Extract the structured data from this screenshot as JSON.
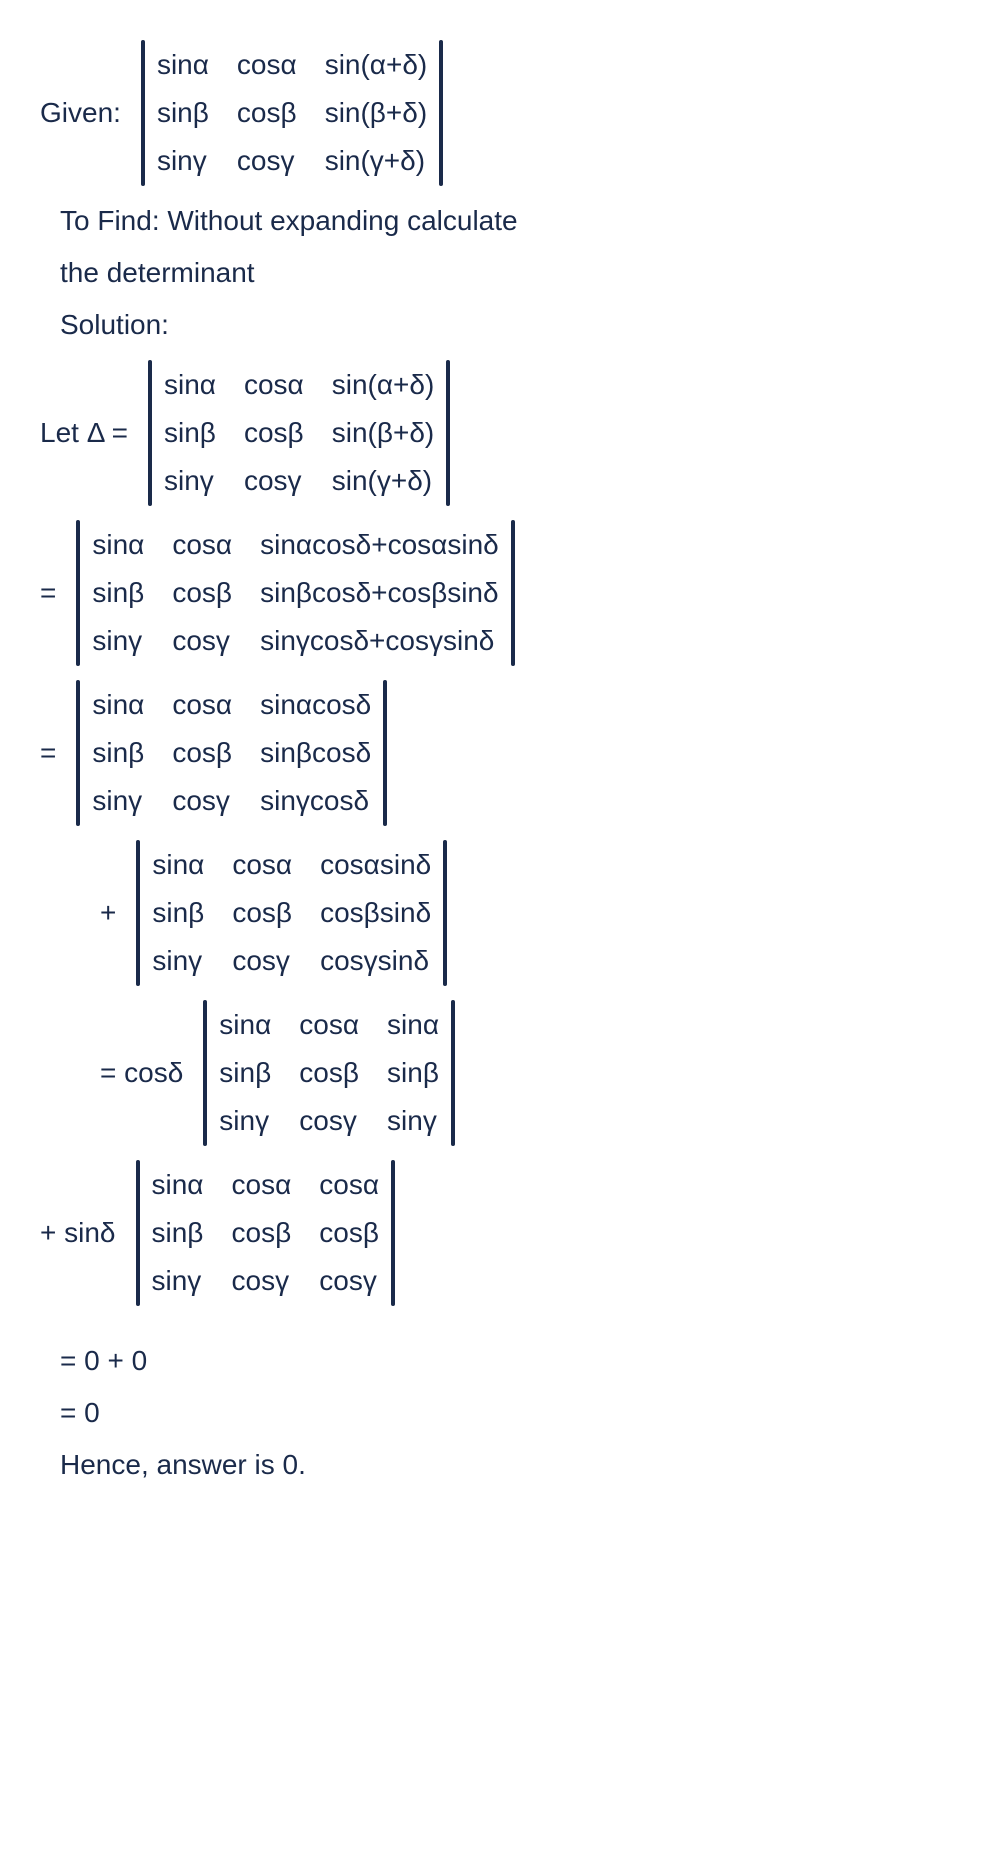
{
  "given_label": "Given:",
  "to_find": "To Find: Without expanding calculate",
  "to_find_2": "the determinant",
  "solution_label": "Solution:",
  "let_delta": "Let Δ =",
  "eq": "=",
  "plus": "+",
  "coeff_cos": "= cosδ",
  "coeff_sin": "+ sinδ",
  "result1": "= 0 + 0",
  "result2": "= 0",
  "answer": "Hence, answer is 0.",
  "m_given": {
    "r1c1": "sinα",
    "r1c2": "cosα",
    "r1c3": "sin(α+δ)",
    "r2c1": "sinβ",
    "r2c2": "cosβ",
    "r2c3": "sin(β+δ)",
    "r3c1": "sinγ",
    "r3c2": "cosγ",
    "r3c3": "sin(γ+δ)"
  },
  "m_delta": {
    "r1c1": "sinα",
    "r1c2": "cosα",
    "r1c3": "sin(α+δ)",
    "r2c1": "sinβ",
    "r2c2": "cosβ",
    "r2c3": "sin(β+δ)",
    "r3c1": "sinγ",
    "r3c2": "cosγ",
    "r3c3": "sin(γ+δ)"
  },
  "m_expand": {
    "r1c1": "sinα",
    "r1c2": "cosα",
    "r1c3": "sinαcosδ+cosαsinδ",
    "r2c1": "sinβ",
    "r2c2": "cosβ",
    "r2c3": "sinβcosδ+cosβsinδ",
    "r3c1": "sinγ",
    "r3c2": "cosγ",
    "r3c3": "sinγcosδ+cosγsinδ"
  },
  "m_split1": {
    "r1c1": "sinα",
    "r1c2": "cosα",
    "r1c3": "sinαcosδ",
    "r2c1": "sinβ",
    "r2c2": "cosβ",
    "r2c3": "sinβcosδ",
    "r3c1": "sinγ",
    "r3c2": "cosγ",
    "r3c3": "sinγcosδ"
  },
  "m_split2": {
    "r1c1": "sinα",
    "r1c2": "cosα",
    "r1c3": "cosαsinδ",
    "r2c1": "sinβ",
    "r2c2": "cosβ",
    "r2c3": "cosβsinδ",
    "r3c1": "sinγ",
    "r3c2": "cosγ",
    "r3c3": "cosγsinδ"
  },
  "m_fac1": {
    "r1c1": "sinα",
    "r1c2": "cosα",
    "r1c3": "sinα",
    "r2c1": "sinβ",
    "r2c2": "cosβ",
    "r2c3": "sinβ",
    "r3c1": "sinγ",
    "r3c2": "cosγ",
    "r3c3": "sinγ"
  },
  "m_fac2": {
    "r1c1": "sinα",
    "r1c2": "cosα",
    "r1c3": "cosα",
    "r2c1": "sinβ",
    "r2c2": "cosβ",
    "r2c3": "cosβ",
    "r3c1": "sinγ",
    "r3c2": "cosγ",
    "r3c3": "cosγ"
  }
}
